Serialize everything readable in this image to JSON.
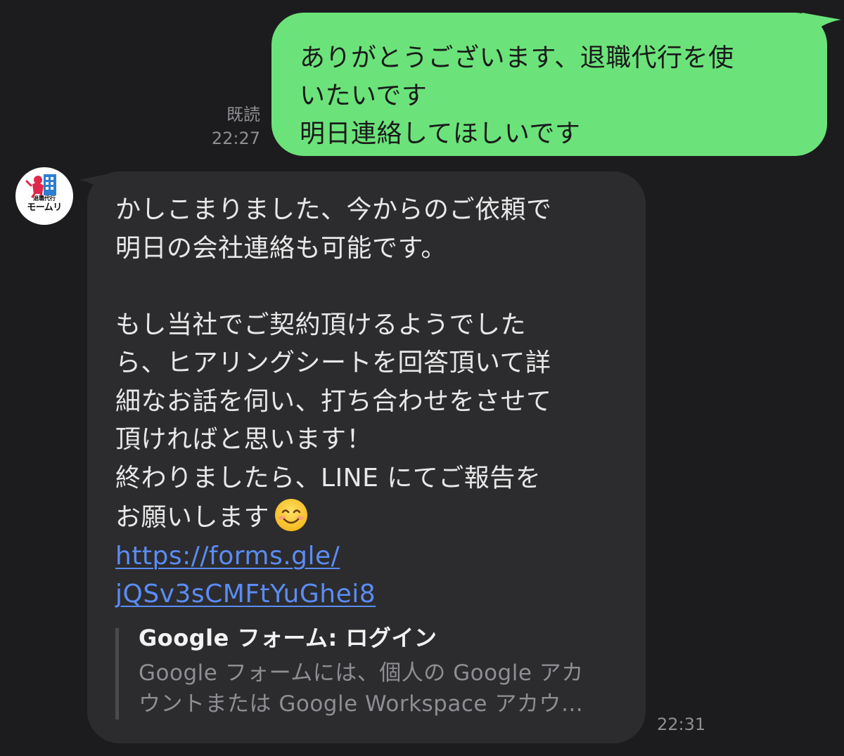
{
  "outgoing_message": {
    "lines": [
      "ありがとうございます、退職代行を使",
      "いたいです",
      "明日連絡してほしいです"
    ],
    "read_label": "既読",
    "time": "22:27"
  },
  "sender": {
    "avatar_icon": "moomuri-logo-icon",
    "avatar_caption_small": "退職代行",
    "avatar_caption_big": "モームリ"
  },
  "incoming_message": {
    "lines": [
      "かしこまりました、今からのご依頼で",
      "明日の会社連絡も可能です。",
      "",
      "もし当社でご契約頂けるようでした",
      "ら、ヒアリングシートを回答頂いて詳",
      "細なお話を伺い、打ち合わせをさせて",
      "頂ければと思います！",
      "終わりましたら、LINE にてご報告を",
      "お願いします"
    ],
    "emoji": "smiling-face-icon",
    "link_lines": [
      "https://forms.gle/",
      "jQSv3sCMFtYuGhei8"
    ],
    "preview": {
      "title": "Google フォーム: ログイン",
      "description_lines": [
        "Google フォームには、個人の Google アカ",
        "ウントまたは Google Workspace アカウ…"
      ]
    },
    "time": "22:31"
  },
  "colors": {
    "background": "#1c1c1e",
    "outgoing_bubble": "#6be37a",
    "incoming_bubble": "#2c2c2e",
    "link": "#5b8cf5",
    "meta_text": "#8e8e93"
  }
}
